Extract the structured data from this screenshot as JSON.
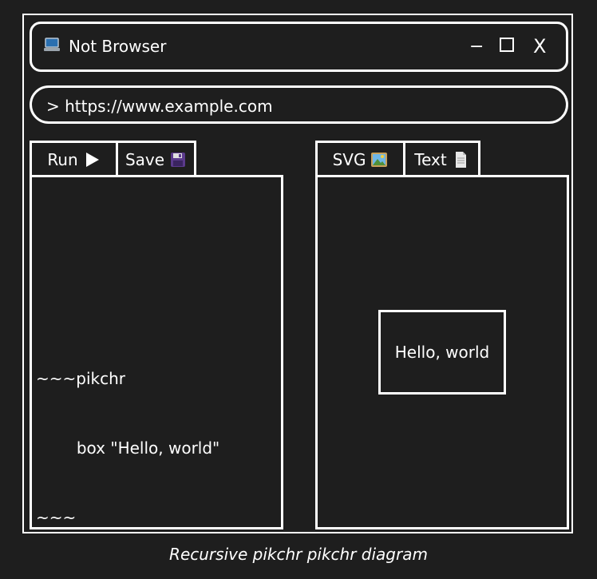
{
  "window": {
    "title": "Not Browser",
    "icon": "laptop-icon",
    "minimize_glyph": "−",
    "close_glyph": "X"
  },
  "address_bar": {
    "text": "> https://www.example.com"
  },
  "editor": {
    "tabs": [
      {
        "label": "Run",
        "icon": "play-icon"
      },
      {
        "label": "Save",
        "icon": "floppy-disk-icon"
      }
    ],
    "code_lines": [
      "~~~pikchr",
      "        box \"Hello, world\"",
      "~~~"
    ]
  },
  "output": {
    "tabs": [
      {
        "label": "SVG",
        "icon": "picture-icon"
      },
      {
        "label": "Text",
        "icon": "document-icon"
      }
    ],
    "box_text": "Hello, world"
  },
  "caption": "Recursive pikchr pikchr diagram",
  "colors": {
    "background": "#1e1e1e",
    "stroke": "#ffffff",
    "play_icon": "#ffffff",
    "floppy_icon": "#5b3a8c",
    "picture_icon_sky": "#6fb6e6",
    "picture_icon_frame": "#c8a15a",
    "document_icon": "#e8e8e8"
  }
}
